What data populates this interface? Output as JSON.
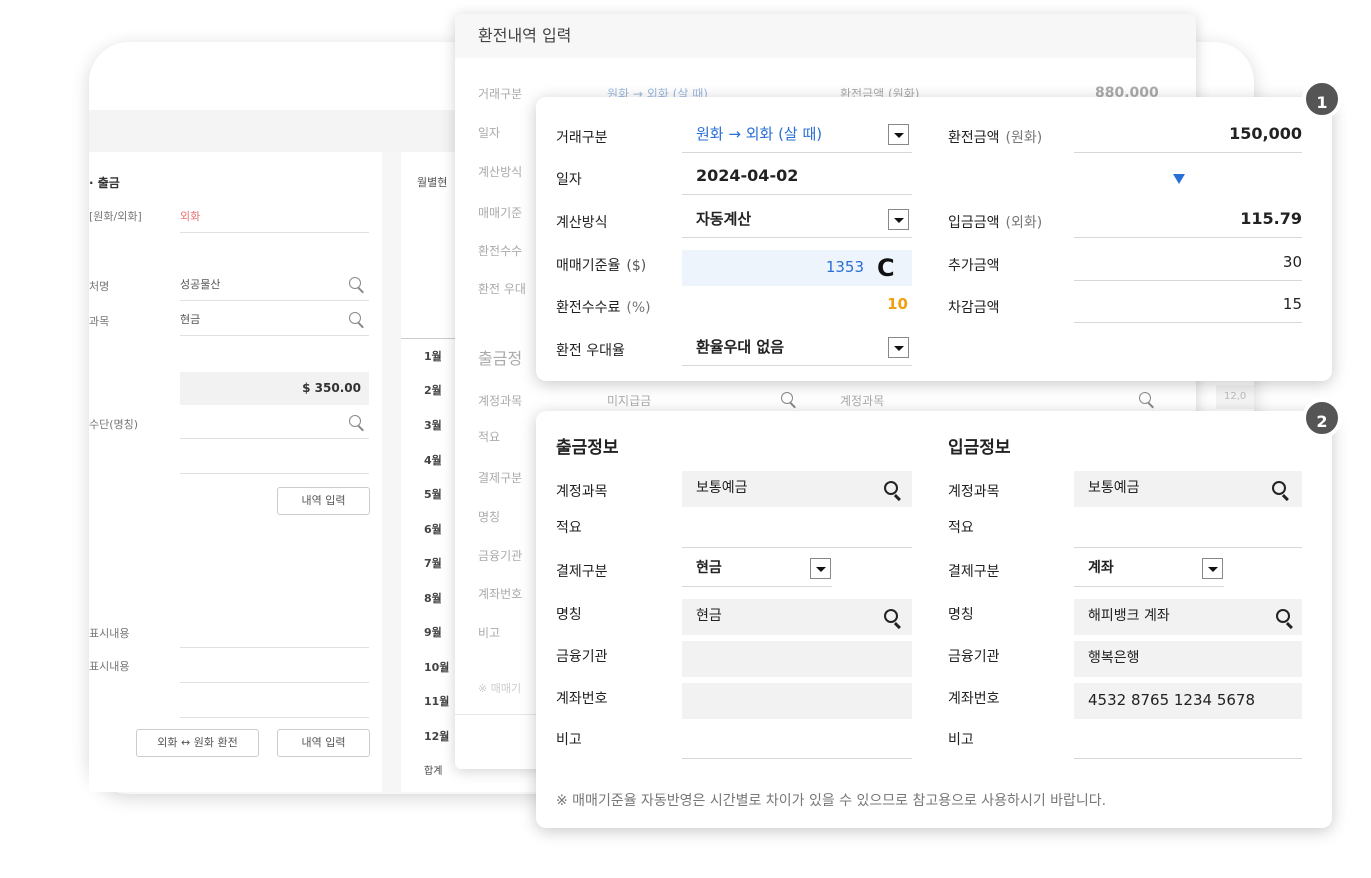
{
  "back_panel": {
    "title": "· 출금",
    "rows": [
      {
        "label": "[원화/외화]",
        "value": "외화"
      },
      {
        "label": "처명",
        "value": "성공물산"
      },
      {
        "label": "과목",
        "value": "현금"
      },
      {
        "label": "",
        "value": "$ 350.00"
      },
      {
        "label": "수단(명칭)",
        "value": ""
      }
    ],
    "entry_button": "내역 입력",
    "display_label_1": "표시내용",
    "display_label_2": "표시내용",
    "exchange_button": "외화 ↔ 원화 환전",
    "entry_button_2": "내역 입력",
    "monthly_header": "월별현",
    "months": [
      "1월",
      "2월",
      "3월",
      "4월",
      "5월",
      "6월",
      "7월",
      "8월",
      "9월",
      "10월",
      "11월",
      "12월"
    ],
    "total_label": "합계",
    "side_value": "12,0"
  },
  "middle_panel": {
    "title": "환전내역 입력",
    "rows": [
      "거래구분",
      "일자",
      "계산방식",
      "매매기준",
      "환전수수",
      "환전 우대"
    ],
    "trade_value": "원화 → 외화 (살 때)",
    "amount_label": "환전금액 (원화)",
    "amount_value": "880,000",
    "section": "출금정",
    "rows2": [
      "계정과목",
      "적요",
      "결제구분",
      "명칭",
      "금융기관",
      "계좌번호",
      "비고"
    ],
    "account_value": "미지급금",
    "account_label_right": "계정과목",
    "note_stub": "※ 매매기"
  },
  "card1": {
    "badge": "1",
    "trade_type": {
      "label": "거래구분",
      "value": "원화 → 외화 (살 때)"
    },
    "date": {
      "label": "일자",
      "value": "2024-04-02"
    },
    "calc_method": {
      "label": "계산방식",
      "value": "자동계산"
    },
    "base_rate": {
      "label": "매매기준율",
      "unit": "($)",
      "value": "1353"
    },
    "fee": {
      "label": "환전수수료",
      "unit": "(%)",
      "value": "10"
    },
    "preference": {
      "label": "환전 우대율",
      "value": "환율우대 없음"
    },
    "exchange_amount": {
      "label": "환전금액",
      "unit": "(원화)",
      "value": "150,000"
    },
    "deposit_amount": {
      "label": "입금금액",
      "unit": "(외화)",
      "value": "115.79"
    },
    "add_amount": {
      "label": "추가금액",
      "value": "30"
    },
    "deduct_amount": {
      "label": "차감금액",
      "value": "15"
    }
  },
  "card2": {
    "badge": "2",
    "withdraw": {
      "title": "출금정보",
      "account_label": "계정과목",
      "account_value": "보통예금",
      "memo_label": "적요",
      "memo_value": "",
      "pay_label": "결제구분",
      "pay_value": "현금",
      "name_label": "명칭",
      "name_value": "현금",
      "bank_label": "금융기관",
      "bank_value": "",
      "acct_no_label": "계좌번호",
      "acct_no_value": "",
      "remark_label": "비고",
      "remark_value": ""
    },
    "deposit": {
      "title": "입금정보",
      "account_label": "계정과목",
      "account_value": "보통예금",
      "memo_label": "적요",
      "memo_value": "",
      "pay_label": "결제구분",
      "pay_value": "계좌",
      "name_label": "명칭",
      "name_value": "해피뱅크 계좌",
      "bank_label": "금융기관",
      "bank_value": "행복은행",
      "acct_no_label": "계좌번호",
      "acct_no_value": "4532 8765 1234 5678",
      "remark_label": "비고",
      "remark_value": ""
    },
    "note": "※ 매매기준율 자동반영은 시간별로 차이가 있을 수 있으므로 참고용으로 사용하시기 바랍니다."
  },
  "colors": {
    "accent_blue": "#2a6fd6",
    "fee_orange": "#f0a010",
    "badge_gray": "#555555",
    "red_text": "#e57373"
  }
}
